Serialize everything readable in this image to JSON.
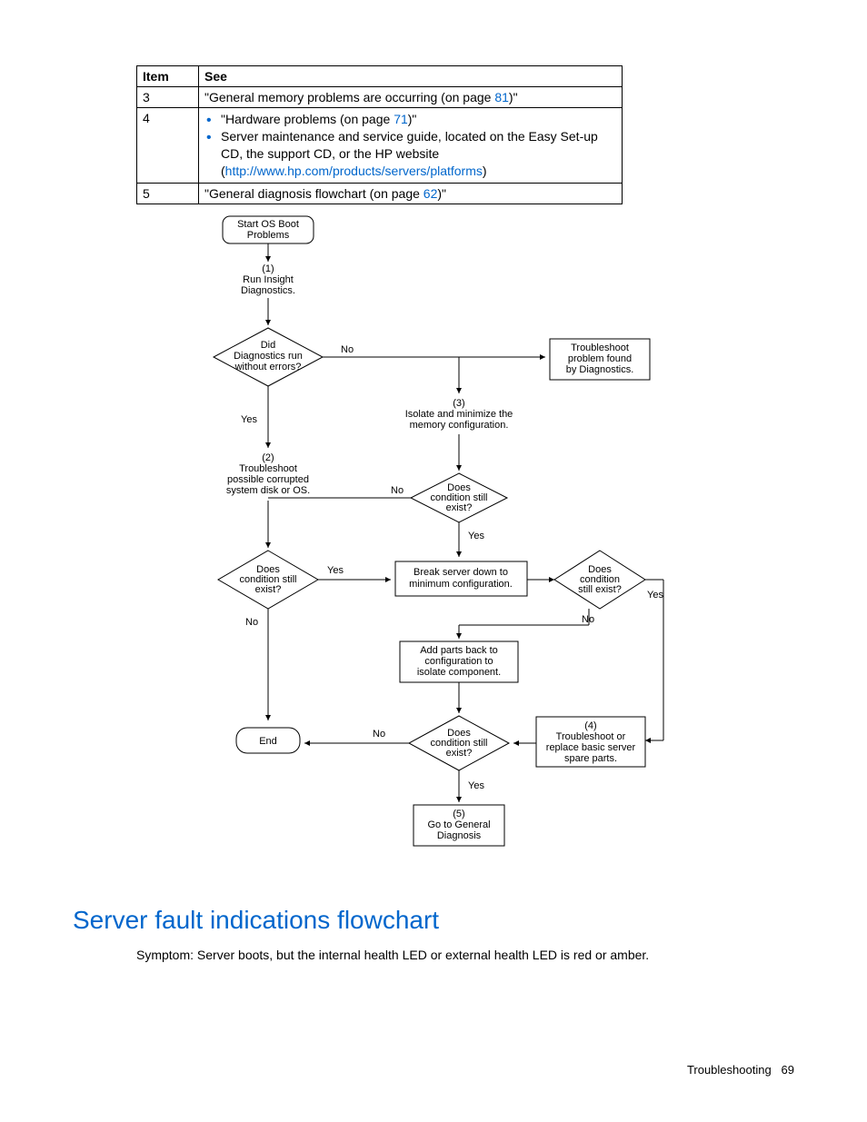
{
  "table": {
    "head_item": "Item",
    "head_see": "See",
    "rows": [
      {
        "item": "3",
        "plain_before": "\"General memory problems are occurring (on page ",
        "link": "81",
        "plain_after": ")\""
      },
      {
        "item": "4",
        "bullets": [
          {
            "before": "\"Hardware problems (on page ",
            "link": "71",
            "after": ")\""
          },
          {
            "text": "Server maintenance and service guide, located on the Easy Set-up CD, the support CD, or the HP website",
            "paren_open": "(",
            "link": "http://www.hp.com/products/servers/platforms",
            "paren_close": ")"
          }
        ]
      },
      {
        "item": "5",
        "plain_before": "\"General diagnosis flowchart (on page ",
        "link": "62",
        "plain_after": ")\""
      }
    ]
  },
  "chart_data": {
    "type": "flowchart",
    "nodes": [
      {
        "id": "start",
        "shape": "terminator",
        "text": "Start OS Boot Problems"
      },
      {
        "id": "n1",
        "shape": "process",
        "text": "(1)\nRun Insight Diagnostics."
      },
      {
        "id": "d1",
        "shape": "decision",
        "text": "Did Diagnostics run without errors?"
      },
      {
        "id": "tdiag",
        "shape": "process",
        "text": "Troubleshoot problem found by Diagnostics."
      },
      {
        "id": "n3",
        "shape": "process",
        "text": "(3)\nIsolate and minimize the memory configuration."
      },
      {
        "id": "n2",
        "shape": "process",
        "text": "(2)\nTroubleshoot possible corrupted system disk or OS."
      },
      {
        "id": "d2",
        "shape": "decision",
        "text": "Does condition still exist?"
      },
      {
        "id": "d3",
        "shape": "decision",
        "text": "Does condition still exist?"
      },
      {
        "id": "brk",
        "shape": "process",
        "text": "Break server down to minimum configuration."
      },
      {
        "id": "d5",
        "shape": "decision",
        "text": "Does condition still exist?"
      },
      {
        "id": "add",
        "shape": "process",
        "text": "Add parts back to configuration to isolate component."
      },
      {
        "id": "end",
        "shape": "terminator",
        "text": "End"
      },
      {
        "id": "d4",
        "shape": "decision",
        "text": "Does condition still exist?"
      },
      {
        "id": "n4",
        "shape": "process",
        "text": "(4)\nTroubleshoot or replace basic server spare parts."
      },
      {
        "id": "n5",
        "shape": "process",
        "text": "(5)\nGo to General Diagnosis"
      }
    ],
    "edges": [
      {
        "from": "start",
        "to": "n1"
      },
      {
        "from": "n1",
        "to": "d1"
      },
      {
        "from": "d1",
        "to": "tdiag",
        "label": "No"
      },
      {
        "from": "d1",
        "to": "n2",
        "label": "Yes"
      },
      {
        "from": "tdiag",
        "to": "n3"
      },
      {
        "from": "n3",
        "to": "d2"
      },
      {
        "from": "d2",
        "to": "brk",
        "label": "Yes"
      },
      {
        "from": "d2",
        "to": "d3_merge",
        "label": "No"
      },
      {
        "from": "n2",
        "to": "d3"
      },
      {
        "from": "d3",
        "to": "brk",
        "label": "Yes"
      },
      {
        "from": "d3",
        "to": "end_merge",
        "label": "No"
      },
      {
        "from": "brk",
        "to": "d5"
      },
      {
        "from": "d5",
        "to": "add",
        "label": "No"
      },
      {
        "from": "d5",
        "to": "n4",
        "label": "Yes"
      },
      {
        "from": "add",
        "to": "d4"
      },
      {
        "from": "n4",
        "to": "d4"
      },
      {
        "from": "d4",
        "to": "end",
        "label": "No"
      },
      {
        "from": "d4",
        "to": "n5",
        "label": "Yes"
      }
    ],
    "edge_labels": {
      "yes": "Yes",
      "no": "No"
    }
  },
  "heading": "Server fault indications flowchart",
  "symptom": "Symptom: Server boots, but the internal health LED or external health LED is red or amber.",
  "footer_label": "Troubleshooting",
  "footer_page": "69"
}
